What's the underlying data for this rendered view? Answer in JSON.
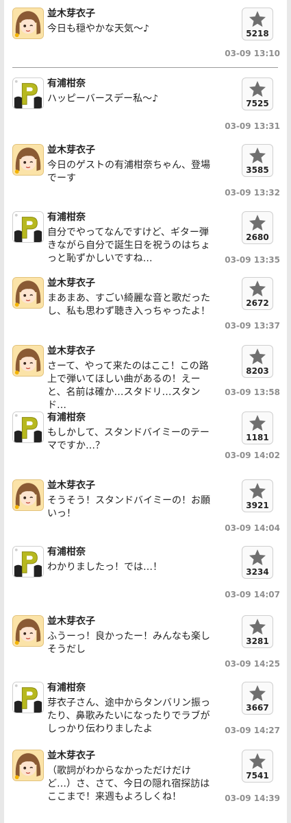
{
  "feed": {
    "posts": [
      {
        "name": "並木芽衣子",
        "message": "今日も穏やかな天気～♪",
        "stars": "5218",
        "time": "03-09 13:10",
        "avatar": "meiko-avatar-icon"
      },
      {
        "name": "有浦柑奈",
        "message": "ハッピーバースデー私～♪",
        "stars": "7525",
        "time": "03-09 13:31",
        "avatar": "kanna-avatar-icon"
      },
      {
        "name": "並木芽衣子",
        "message": "今日のゲストの有浦柑奈ちゃん、登場\nでーす",
        "stars": "3585",
        "time": "03-09 13:32",
        "avatar": "meiko-avatar-icon"
      },
      {
        "name": "有浦柑奈",
        "message": "自分でやってなんですけど、ギター弾\nきながら自分で誕生日を祝うのはちょ\nっと恥ずかしいですね…",
        "stars": "2680",
        "time": "03-09 13:35",
        "avatar": "kanna-avatar-icon"
      },
      {
        "name": "並木芽衣子",
        "message": "まあまあ、すごい綺麗な音と歌だった\nし、私も思わず聴き入っちゃったよ！",
        "stars": "2672",
        "time": "03-09 13:37",
        "avatar": "meiko-avatar-icon"
      },
      {
        "name": "並木芽衣子",
        "message": "さーて、やって来たのはここ！この路\n上で弾いてほしい曲があるの！えー\nと、名前は確か…スタドリ…スタン\nド…",
        "stars": "8203",
        "time": "03-09 13:58",
        "avatar": "meiko-avatar-icon"
      },
      {
        "name": "有浦柑奈",
        "message": "もしかして、スタンドバイミーのテー\nマですか…？",
        "stars": "1181",
        "time": "03-09 14:02",
        "avatar": "kanna-avatar-icon"
      },
      {
        "name": "並木芽衣子",
        "message": "そうそう！スタンドバイミーの！お願\nいっ！",
        "stars": "3921",
        "time": "03-09 14:04",
        "avatar": "meiko-avatar-icon"
      },
      {
        "name": "有浦柑奈",
        "message": "わかりましたっ！では…！",
        "stars": "3234",
        "time": "03-09 14:07",
        "avatar": "kanna-avatar-icon"
      },
      {
        "name": "並木芽衣子",
        "message": "ふうーっ！良かったー！みんなも楽し\nそうだし",
        "stars": "3281",
        "time": "03-09 14:25",
        "avatar": "meiko-avatar-icon"
      },
      {
        "name": "有浦柑奈",
        "message": "芽衣子さん、途中からタンバリン振っ\nたり、鼻歌みたいになったりでラブが\nしっかり伝わりましたよ",
        "stars": "3667",
        "time": "03-09 14:27",
        "avatar": "kanna-avatar-icon"
      },
      {
        "name": "並木芽衣子",
        "message": "（歌詞がわからなかっただけだけ\nど…）さ、さて、今日の隠れ宿探訪は\nここまで！来週もよろしくね！",
        "stars": "7541",
        "time": "03-09 14:39",
        "avatar": "meiko-avatar-icon"
      }
    ]
  },
  "colors": {
    "star": "#6f6f6f",
    "time": "#8e8e8e",
    "kanna_badge": "#b7b81f",
    "meiko_hair": "#8a5a34"
  }
}
